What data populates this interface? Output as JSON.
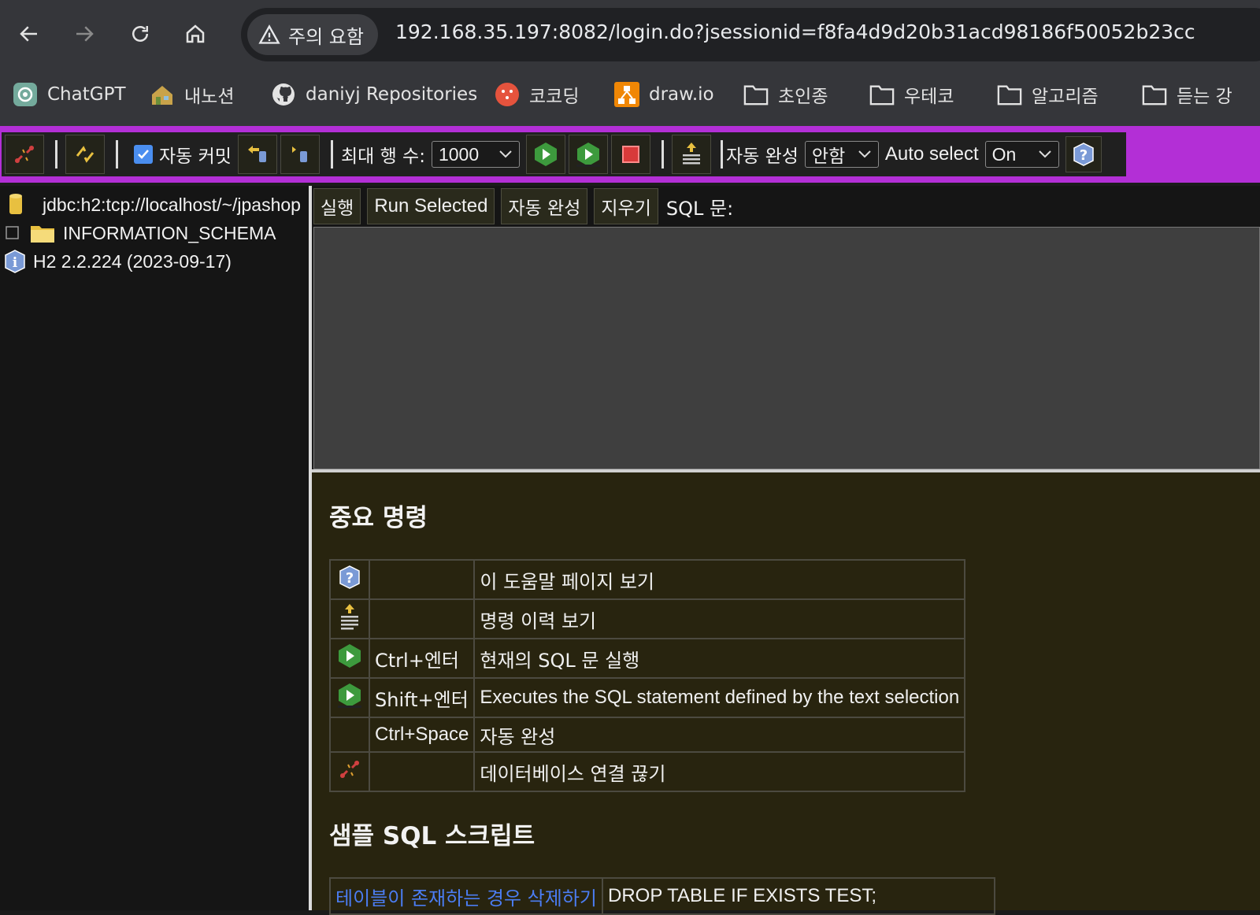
{
  "browser": {
    "security_label": "주의 요함",
    "url": "192.168.35.197:8082/login.do?jsessionid=f8fa4d9d20b31acd98186f50052b23cc",
    "bookmarks": [
      "ChatGPT",
      "내노션",
      "daniyj Repositories",
      "코코딩",
      "draw.io",
      "초인종",
      "우테코",
      "알고리즘",
      "듣는 강"
    ]
  },
  "toolbar": {
    "auto_commit_label": "자동 커밋",
    "auto_commit_checked": true,
    "max_rows_label": "최대 행 수:",
    "max_rows_value": "1000",
    "autocomplete_label": "자동 완성",
    "autocomplete_value": "안함",
    "auto_select_label": "Auto select",
    "auto_select_value": "On",
    "accent_color": "#b32fd6"
  },
  "tree": {
    "connection": "jdbc:h2:tcp://localhost/~/jpashop",
    "schema": "INFORMATION_SCHEMA",
    "version": "H2 2.2.224 (2023-09-17)"
  },
  "query": {
    "run_label": "실행",
    "run_selected_label": "Run Selected",
    "autocomplete_label": "자동 완성",
    "clear_label": "지우기",
    "sql_label": "SQL 문:"
  },
  "help": {
    "important_title": "중요 명령",
    "commands": [
      {
        "icon": "help-icon",
        "key": "",
        "desc": "이 도움말 페이지 보기"
      },
      {
        "icon": "history-icon",
        "key": "",
        "desc": "명령 이력 보기"
      },
      {
        "icon": "run-icon",
        "key": "Ctrl+엔터",
        "desc": "현재의 SQL 문 실행"
      },
      {
        "icon": "run-selected-icon",
        "key": "Shift+엔터",
        "desc": "Executes the SQL statement defined by the text selection"
      },
      {
        "icon": "",
        "key": "Ctrl+Space",
        "desc": "자동 완성"
      },
      {
        "icon": "disconnect-icon",
        "key": "",
        "desc": "데이터베이스 연결 끊기"
      }
    ],
    "sample_title": "샘플 SQL 스크립트",
    "samples": [
      {
        "label": "테이블이 존재하는 경우 삭제하기",
        "sql": "DROP TABLE IF EXISTS TEST;"
      }
    ]
  }
}
